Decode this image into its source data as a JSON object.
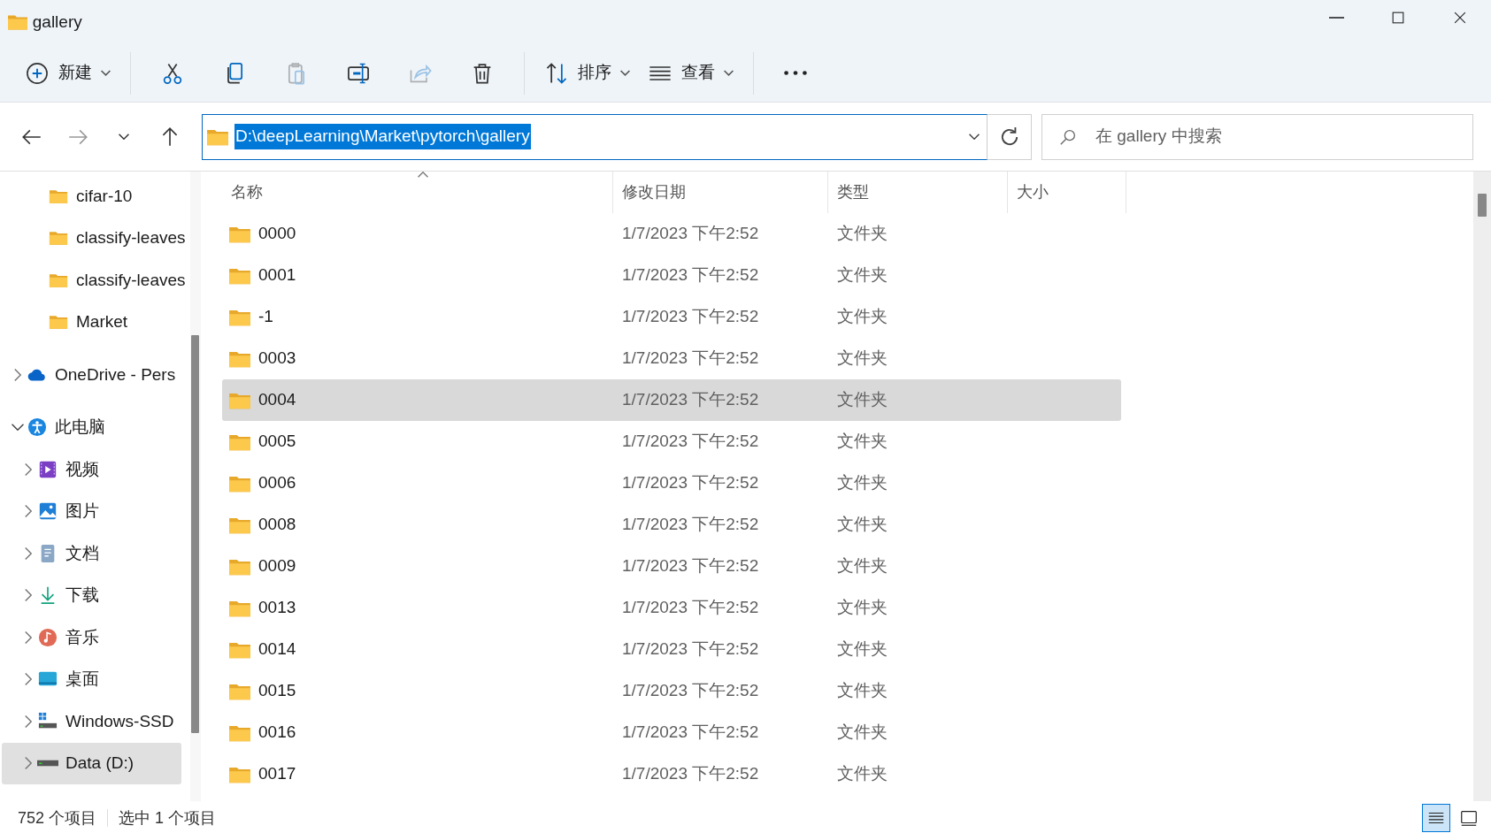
{
  "window": {
    "title": "gallery"
  },
  "toolbar": [
    {
      "kind": "new",
      "label": "新建",
      "disabled": false
    },
    {
      "kind": "cut",
      "disabled": false
    },
    {
      "kind": "copy",
      "disabled": false
    },
    {
      "kind": "paste",
      "disabled": true
    },
    {
      "kind": "rename",
      "disabled": false
    },
    {
      "kind": "share",
      "disabled": true
    },
    {
      "kind": "delete",
      "disabled": false
    },
    {
      "kind": "sort",
      "label": "排序",
      "disabled": false
    },
    {
      "kind": "view",
      "label": "查看",
      "disabled": false
    },
    {
      "kind": "more",
      "disabled": false
    }
  ],
  "address": {
    "path": "D:\\deepLearning\\Market\\pytorch\\gallery",
    "highlighted": true
  },
  "search": {
    "placeholder": "在 gallery 中搜索"
  },
  "sidebar": {
    "items": [
      {
        "children": [
          {
            "kind": "folder",
            "label": "cifar-10",
            "selected": false
          },
          {
            "kind": "folder",
            "label": "classify-leaves",
            "selected": false
          },
          {
            "kind": "folder",
            "label": "classify-leaves",
            "selected": false
          },
          {
            "kind": "folder",
            "label": "Market",
            "selected": false
          }
        ]
      },
      {
        "kind": "cloud",
        "label": "OneDrive - Pers",
        "expanded": false,
        "selected": false
      },
      {
        "kind": "pc",
        "label": "此电脑",
        "expanded": true,
        "selected": false,
        "children": [
          {
            "kind": "video",
            "label": "视频",
            "expanded": false,
            "selected": false
          },
          {
            "kind": "pictures",
            "label": "图片",
            "expanded": false,
            "selected": false
          },
          {
            "kind": "documents",
            "label": "文档",
            "expanded": false,
            "selected": false
          },
          {
            "kind": "downloads",
            "label": "下载",
            "expanded": false,
            "selected": false
          },
          {
            "kind": "music",
            "label": "音乐",
            "expanded": false,
            "selected": false
          },
          {
            "kind": "desktop",
            "label": "桌面",
            "expanded": false,
            "selected": false
          },
          {
            "kind": "windows-drive",
            "label": "Windows-SSD",
            "expanded": false,
            "selected": false
          },
          {
            "kind": "drive",
            "label": "Data (D:)",
            "expanded": false,
            "selected": true
          }
        ]
      }
    ]
  },
  "table": {
    "columns": [
      {
        "label": "名称",
        "sorted": true
      },
      {
        "label": "修改日期",
        "sorted": false
      },
      {
        "label": "类型",
        "sorted": false
      },
      {
        "label": "大小",
        "sorted": false
      }
    ],
    "rows": [
      {
        "name": "0000",
        "modified": "1/7/2023 下午2:52",
        "type": "文件夹",
        "selected": false
      },
      {
        "name": "0001",
        "modified": "1/7/2023 下午2:52",
        "type": "文件夹",
        "selected": false
      },
      {
        "name": "-1",
        "modified": "1/7/2023 下午2:52",
        "type": "文件夹",
        "selected": false
      },
      {
        "name": "0003",
        "modified": "1/7/2023 下午2:52",
        "type": "文件夹",
        "selected": false
      },
      {
        "name": "0004",
        "modified": "1/7/2023 下午2:52",
        "type": "文件夹",
        "selected": true
      },
      {
        "name": "0005",
        "modified": "1/7/2023 下午2:52",
        "type": "文件夹",
        "selected": false
      },
      {
        "name": "0006",
        "modified": "1/7/2023 下午2:52",
        "type": "文件夹",
        "selected": false
      },
      {
        "name": "0008",
        "modified": "1/7/2023 下午2:52",
        "type": "文件夹",
        "selected": false
      },
      {
        "name": "0009",
        "modified": "1/7/2023 下午2:52",
        "type": "文件夹",
        "selected": false
      },
      {
        "name": "0013",
        "modified": "1/7/2023 下午2:52",
        "type": "文件夹",
        "selected": false
      },
      {
        "name": "0014",
        "modified": "1/7/2023 下午2:52",
        "type": "文件夹",
        "selected": false
      },
      {
        "name": "0015",
        "modified": "1/7/2023 下午2:52",
        "type": "文件夹",
        "selected": false
      },
      {
        "name": "0016",
        "modified": "1/7/2023 下午2:52",
        "type": "文件夹",
        "selected": false
      },
      {
        "name": "0017",
        "modified": "1/7/2023 下午2:52",
        "type": "文件夹",
        "selected": false
      }
    ]
  },
  "status_bar": {
    "item_count": "752 个项目",
    "selection": "选中 1 个项目"
  },
  "view_modes": [
    {
      "kind": "details",
      "selected": true
    },
    {
      "kind": "tiles",
      "selected": false
    }
  ]
}
